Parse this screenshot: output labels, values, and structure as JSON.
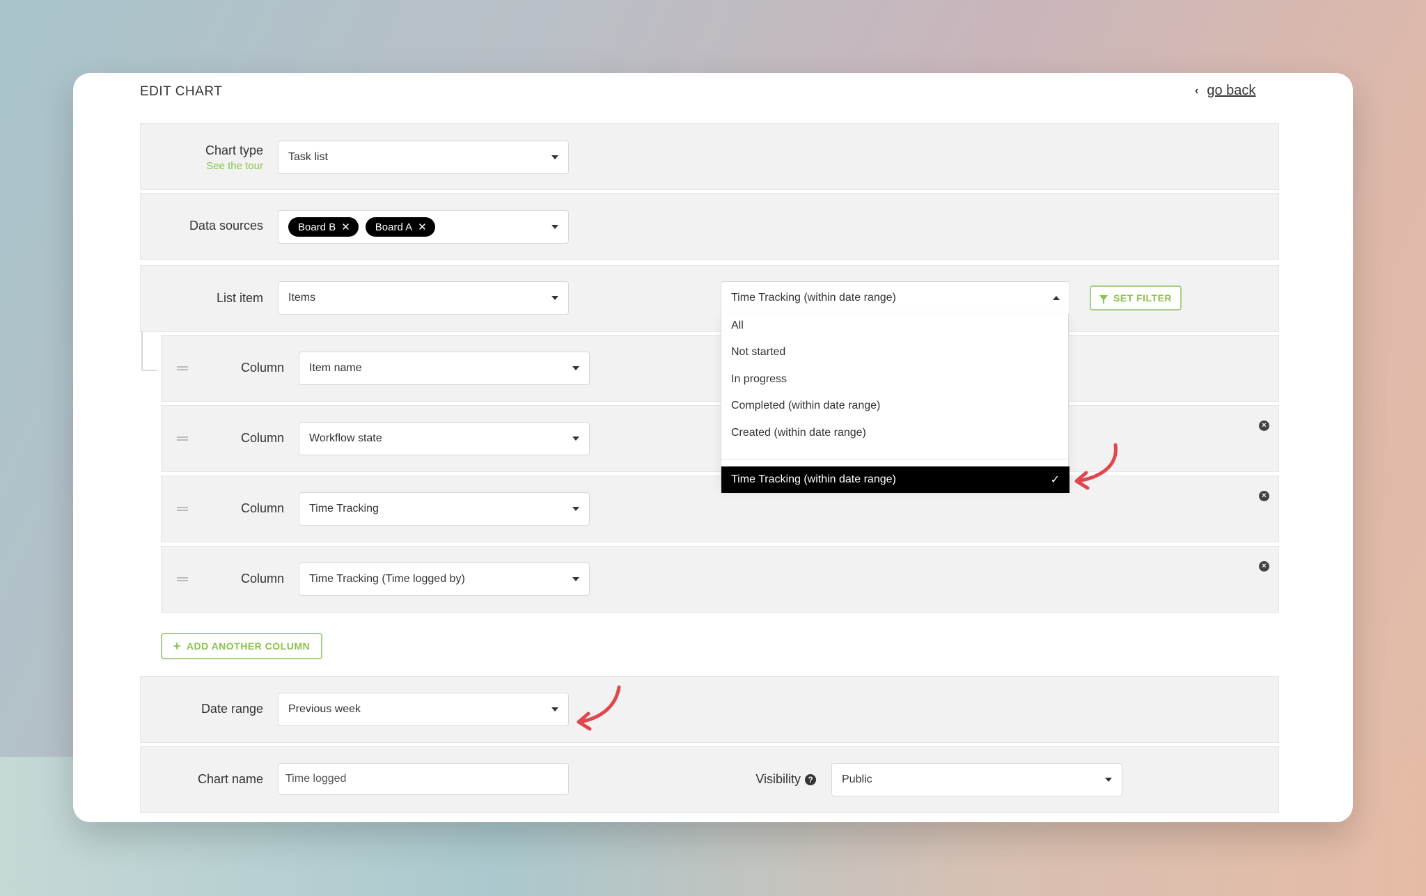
{
  "page": {
    "title": "EDIT CHART",
    "back_label": "go back"
  },
  "chart_type": {
    "label": "Chart type",
    "tour_link": "See the tour",
    "value": "Task list"
  },
  "data_sources": {
    "label": "Data sources",
    "chips": [
      "Board B",
      "Board A"
    ]
  },
  "list_item": {
    "label": "List item",
    "value": "Items",
    "filter_value": "Time Tracking (within date range)",
    "set_filter_label": "SET FILTER"
  },
  "filter_dropdown": {
    "options": [
      "All",
      "Not started",
      "In progress",
      "Completed (within date range)",
      "Created (within date range)"
    ],
    "selected": "Time Tracking (within date range)"
  },
  "columns": [
    {
      "label": "Column",
      "value": "Item name"
    },
    {
      "label": "Column",
      "value": "Workflow state"
    },
    {
      "label": "Column",
      "value": "Time Tracking"
    },
    {
      "label": "Column",
      "value": "Time Tracking (Time logged by)"
    }
  ],
  "add_column_label": "ADD ANOTHER COLUMN",
  "date_range": {
    "label": "Date range",
    "value": "Previous week"
  },
  "chart_name": {
    "label": "Chart name",
    "value": "Time logged"
  },
  "visibility": {
    "label": "Visibility",
    "value": "Public"
  },
  "colors": {
    "accent": "#8bc34a",
    "annotation_arrow": "#e0474c",
    "selected_bg": "#000000"
  }
}
